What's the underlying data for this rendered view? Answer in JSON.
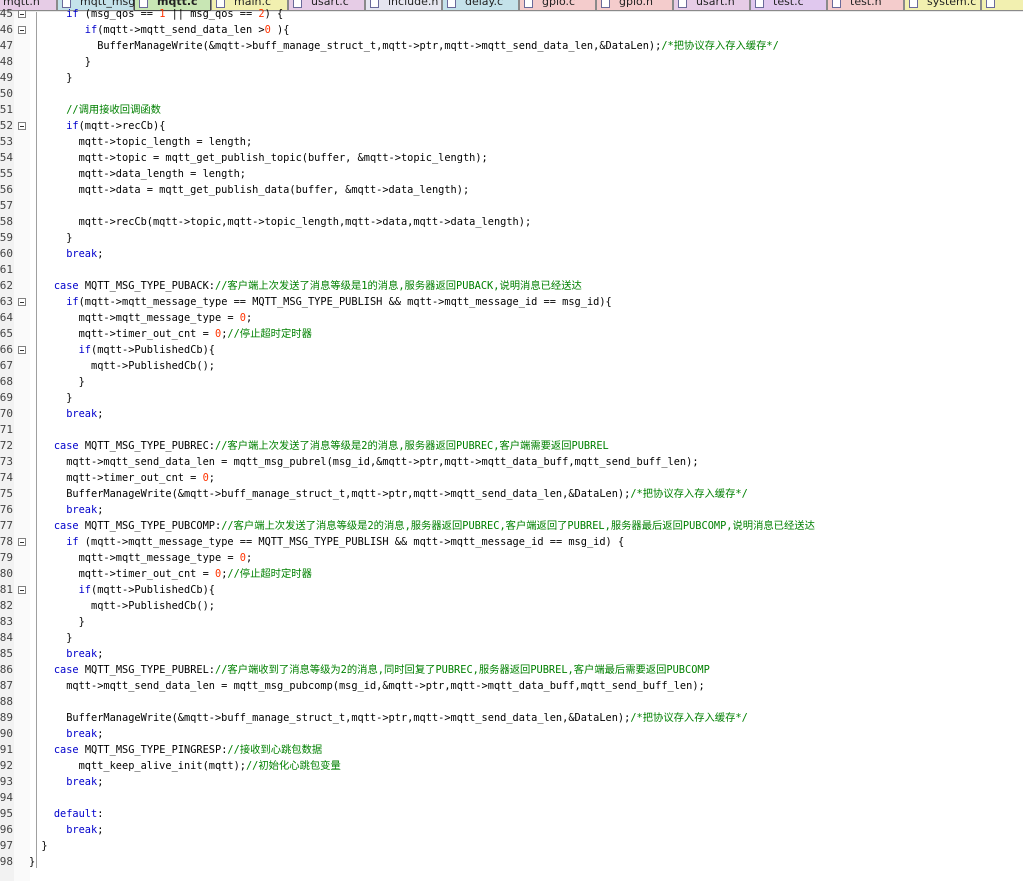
{
  "tabs": [
    {
      "label": "mqtt.h",
      "color": "#e6cce6"
    },
    {
      "label": "mqtt_msg.c",
      "color": "#c4e2ea"
    },
    {
      "label": "mqtt.c",
      "color": "#c8e6b4",
      "active": true
    },
    {
      "label": "main.c",
      "color": "#f2f0b0"
    },
    {
      "label": "usart.c",
      "color": "#e6cce6"
    },
    {
      "label": "include.h",
      "color": "#e6e6f0"
    },
    {
      "label": "delay.c",
      "color": "#c4e2ea"
    },
    {
      "label": "gpio.c",
      "color": "#f4cccc"
    },
    {
      "label": "gpio.h",
      "color": "#f4cccc"
    },
    {
      "label": "usart.h",
      "color": "#e6cce6"
    },
    {
      "label": "test.c",
      "color": "#e0c8ee"
    },
    {
      "label": "test.h",
      "color": "#f4cccc"
    },
    {
      "label": "system.c",
      "color": "#f2f0b0"
    },
    {
      "label": "",
      "color": "#f2f0b0"
    }
  ],
  "lines": [
    {
      "n": "45",
      "fold": true,
      "segs": [
        [
          "      ",
          ""
        ],
        [
          "if",
          "kw"
        ],
        [
          " (msg_qos == ",
          ""
        ],
        [
          "1",
          "num"
        ],
        [
          " || msg_qos == ",
          ""
        ],
        [
          "2",
          "num"
        ],
        [
          ") {",
          ""
        ]
      ]
    },
    {
      "n": "46",
      "fold": true,
      "segs": [
        [
          "         ",
          ""
        ],
        [
          "if",
          "kw"
        ],
        [
          "(mqtt->mqtt_send_data_len >",
          ""
        ],
        [
          "0",
          "num"
        ],
        [
          " ){",
          ""
        ]
      ]
    },
    {
      "n": "47",
      "segs": [
        [
          "           BufferManageWrite(&mqtt->buff_manage_struct_t,mqtt->ptr,mqtt->mqtt_send_data_len,&DataLen);",
          ""
        ],
        [
          "/*把协议存入存入缓存*/",
          "cm"
        ]
      ]
    },
    {
      "n": "48",
      "segs": [
        [
          "         }",
          ""
        ]
      ]
    },
    {
      "n": "49",
      "segs": [
        [
          "      }",
          ""
        ]
      ]
    },
    {
      "n": "50",
      "segs": [
        [
          "",
          ""
        ]
      ]
    },
    {
      "n": "51",
      "segs": [
        [
          "      ",
          ""
        ],
        [
          "//调用接收回调函数",
          "cm"
        ]
      ]
    },
    {
      "n": "52",
      "fold": true,
      "segs": [
        [
          "      ",
          ""
        ],
        [
          "if",
          "kw"
        ],
        [
          "(mqtt->recCb){",
          ""
        ]
      ]
    },
    {
      "n": "53",
      "segs": [
        [
          "        mqtt->topic_length = length;",
          ""
        ]
      ]
    },
    {
      "n": "54",
      "segs": [
        [
          "        mqtt->topic = mqtt_get_publish_topic(buffer, &mqtt->topic_length);",
          ""
        ]
      ]
    },
    {
      "n": "55",
      "segs": [
        [
          "        mqtt->data_length = length;",
          ""
        ]
      ]
    },
    {
      "n": "56",
      "segs": [
        [
          "        mqtt->data = mqtt_get_publish_data(buffer, &mqtt->data_length);",
          ""
        ]
      ]
    },
    {
      "n": "57",
      "segs": [
        [
          "",
          ""
        ]
      ]
    },
    {
      "n": "58",
      "segs": [
        [
          "        mqtt->recCb(mqtt->topic,mqtt->topic_length,mqtt->data,mqtt->data_length);",
          ""
        ]
      ]
    },
    {
      "n": "59",
      "segs": [
        [
          "      }",
          ""
        ]
      ]
    },
    {
      "n": "60",
      "segs": [
        [
          "      ",
          ""
        ],
        [
          "break",
          "kw"
        ],
        [
          ";",
          ""
        ]
      ]
    },
    {
      "n": "61",
      "segs": [
        [
          "",
          ""
        ]
      ]
    },
    {
      "n": "62",
      "segs": [
        [
          "    ",
          ""
        ],
        [
          "case",
          "kw"
        ],
        [
          " MQTT_MSG_TYPE_PUBACK:",
          ""
        ],
        [
          "//客户端上次发送了消息等级是1的消息,服务器返回PUBACK,说明消息已经送达",
          "cm"
        ]
      ]
    },
    {
      "n": "63",
      "fold": true,
      "segs": [
        [
          "      ",
          ""
        ],
        [
          "if",
          "kw"
        ],
        [
          "(mqtt->mqtt_message_type == MQTT_MSG_TYPE_PUBLISH && mqtt->mqtt_message_id == msg_id){",
          ""
        ]
      ]
    },
    {
      "n": "64",
      "segs": [
        [
          "        mqtt->mqtt_message_type = ",
          ""
        ],
        [
          "0",
          "num"
        ],
        [
          ";",
          ""
        ]
      ]
    },
    {
      "n": "65",
      "segs": [
        [
          "        mqtt->timer_out_cnt = ",
          ""
        ],
        [
          "0",
          "num"
        ],
        [
          ";",
          ""
        ],
        [
          "//停止超时定时器",
          "cm"
        ]
      ]
    },
    {
      "n": "66",
      "fold": true,
      "segs": [
        [
          "        ",
          ""
        ],
        [
          "if",
          "kw"
        ],
        [
          "(mqtt->PublishedCb){",
          ""
        ]
      ]
    },
    {
      "n": "67",
      "segs": [
        [
          "          mqtt->PublishedCb();",
          ""
        ]
      ]
    },
    {
      "n": "68",
      "segs": [
        [
          "        }",
          ""
        ]
      ]
    },
    {
      "n": "69",
      "segs": [
        [
          "      }",
          ""
        ]
      ]
    },
    {
      "n": "70",
      "segs": [
        [
          "      ",
          ""
        ],
        [
          "break",
          "kw"
        ],
        [
          ";",
          ""
        ]
      ]
    },
    {
      "n": "71",
      "segs": [
        [
          "",
          ""
        ]
      ]
    },
    {
      "n": "72",
      "segs": [
        [
          "    ",
          ""
        ],
        [
          "case",
          "kw"
        ],
        [
          " MQTT_MSG_TYPE_PUBREC:",
          ""
        ],
        [
          "//客户端上次发送了消息等级是2的消息,服务器返回PUBREC,客户端需要返回PUBREL",
          "cm"
        ]
      ]
    },
    {
      "n": "73",
      "segs": [
        [
          "      mqtt->mqtt_send_data_len = mqtt_msg_pubrel(msg_id,&mqtt->ptr,mqtt->mqtt_data_buff,mqtt_send_buff_len);",
          ""
        ]
      ]
    },
    {
      "n": "74",
      "segs": [
        [
          "      mqtt->timer_out_cnt = ",
          ""
        ],
        [
          "0",
          "num"
        ],
        [
          ";",
          ""
        ]
      ]
    },
    {
      "n": "75",
      "segs": [
        [
          "      BufferManageWrite(&mqtt->buff_manage_struct_t,mqtt->ptr,mqtt->mqtt_send_data_len,&DataLen);",
          ""
        ],
        [
          "/*把协议存入存入缓存*/",
          "cm"
        ]
      ]
    },
    {
      "n": "76",
      "segs": [
        [
          "      ",
          ""
        ],
        [
          "break",
          "kw"
        ],
        [
          ";",
          ""
        ]
      ]
    },
    {
      "n": "77",
      "segs": [
        [
          "    ",
          ""
        ],
        [
          "case",
          "kw"
        ],
        [
          " MQTT_MSG_TYPE_PUBCOMP:",
          ""
        ],
        [
          "//客户端上次发送了消息等级是2的消息,服务器返回PUBREC,客户端返回了PUBREL,服务器最后返回PUBCOMP,说明消息已经送达",
          "cm"
        ]
      ]
    },
    {
      "n": "78",
      "fold": true,
      "segs": [
        [
          "      ",
          ""
        ],
        [
          "if",
          "kw"
        ],
        [
          " (mqtt->mqtt_message_type == MQTT_MSG_TYPE_PUBLISH && mqtt->mqtt_message_id == msg_id) {",
          ""
        ]
      ]
    },
    {
      "n": "79",
      "segs": [
        [
          "        mqtt->mqtt_message_type = ",
          ""
        ],
        [
          "0",
          "num"
        ],
        [
          ";",
          ""
        ]
      ]
    },
    {
      "n": "80",
      "segs": [
        [
          "        mqtt->timer_out_cnt = ",
          ""
        ],
        [
          "0",
          "num"
        ],
        [
          ";",
          ""
        ],
        [
          "//停止超时定时器",
          "cm"
        ]
      ]
    },
    {
      "n": "81",
      "fold": true,
      "segs": [
        [
          "        ",
          ""
        ],
        [
          "if",
          "kw"
        ],
        [
          "(mqtt->PublishedCb){",
          ""
        ]
      ]
    },
    {
      "n": "82",
      "segs": [
        [
          "          mqtt->PublishedCb();",
          ""
        ]
      ]
    },
    {
      "n": "83",
      "segs": [
        [
          "        }",
          ""
        ]
      ]
    },
    {
      "n": "84",
      "segs": [
        [
          "      }",
          ""
        ]
      ]
    },
    {
      "n": "85",
      "segs": [
        [
          "      ",
          ""
        ],
        [
          "break",
          "kw"
        ],
        [
          ";",
          ""
        ]
      ]
    },
    {
      "n": "86",
      "segs": [
        [
          "    ",
          ""
        ],
        [
          "case",
          "kw"
        ],
        [
          " MQTT_MSG_TYPE_PUBREL:",
          ""
        ],
        [
          "//客户端收到了消息等级为2的消息,同时回复了PUBREC,服务器返回PUBREL,客户端最后需要返回PUBCOMP",
          "cm"
        ]
      ]
    },
    {
      "n": "87",
      "segs": [
        [
          "      mqtt->mqtt_send_data_len = mqtt_msg_pubcomp(msg_id,&mqtt->ptr,mqtt->mqtt_data_buff,mqtt_send_buff_len);",
          ""
        ]
      ]
    },
    {
      "n": "88",
      "segs": [
        [
          "",
          ""
        ]
      ]
    },
    {
      "n": "89",
      "segs": [
        [
          "      BufferManageWrite(&mqtt->buff_manage_struct_t,mqtt->ptr,mqtt->mqtt_send_data_len,&DataLen);",
          ""
        ],
        [
          "/*把协议存入存入缓存*/",
          "cm"
        ]
      ]
    },
    {
      "n": "90",
      "segs": [
        [
          "      ",
          ""
        ],
        [
          "break",
          "kw"
        ],
        [
          ";",
          ""
        ]
      ]
    },
    {
      "n": "91",
      "segs": [
        [
          "    ",
          ""
        ],
        [
          "case",
          "kw"
        ],
        [
          " MQTT_MSG_TYPE_PINGRESP:",
          ""
        ],
        [
          "//接收到心跳包数据",
          "cm"
        ]
      ]
    },
    {
      "n": "92",
      "segs": [
        [
          "        mqtt_keep_alive_init(mqtt);",
          ""
        ],
        [
          "//初始化心跳包变量",
          "cm"
        ]
      ]
    },
    {
      "n": "93",
      "segs": [
        [
          "      ",
          ""
        ],
        [
          "break",
          "kw"
        ],
        [
          ";",
          ""
        ]
      ]
    },
    {
      "n": "94",
      "segs": [
        [
          "",
          ""
        ]
      ]
    },
    {
      "n": "95",
      "segs": [
        [
          "    ",
          ""
        ],
        [
          "default",
          "kw"
        ],
        [
          ":",
          ""
        ]
      ]
    },
    {
      "n": "96",
      "segs": [
        [
          "      ",
          ""
        ],
        [
          "break",
          "kw"
        ],
        [
          ";",
          ""
        ]
      ]
    },
    {
      "n": "97",
      "segs": [
        [
          "  }",
          ""
        ]
      ]
    },
    {
      "n": "98",
      "segs": [
        [
          "}",
          ""
        ]
      ]
    }
  ]
}
